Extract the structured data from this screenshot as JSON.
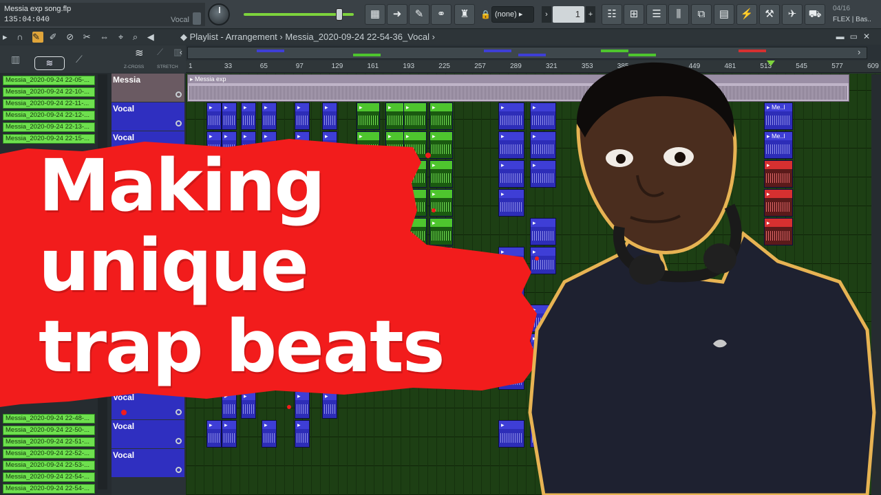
{
  "app": {
    "song_file": "Messia exp song.flp",
    "song_time": "135:04:040",
    "channel_label": "Vocal",
    "pattern_selector": "(none)",
    "pattern_number": "1",
    "version_date": "04/16",
    "version_plugin": "FLEX | Bas.."
  },
  "toolbar": {
    "icons": [
      "piano-icon",
      "arrow-right-icon",
      "brush-icon",
      "link-icon",
      "stamp-icon",
      "playlist-icon",
      "piano-roll-icon",
      "channel-rack-icon",
      "mixer-icon",
      "browser-icon",
      "file-icon",
      "plugin-icon",
      "person-icon",
      "bird-icon",
      "cart-icon"
    ]
  },
  "playlist": {
    "title": "Playlist - Arrangement",
    "separator": "›",
    "selected_clip": "Messia_2020-09-24 22-54-36_Vocal",
    "zcross_label": "Z-CROSS",
    "stretch_label": "STRETCH",
    "ruler_ticks": [
      "1",
      "33",
      "65",
      "97",
      "129",
      "161",
      "193",
      "225",
      "257",
      "289",
      "321",
      "353",
      "385",
      "417",
      "449",
      "481",
      "513",
      "545",
      "577",
      "609"
    ],
    "tracks": [
      {
        "name": "Messia",
        "clip_label": "Messia exp"
      },
      {
        "name": "Vocal"
      },
      {
        "name": "Vocal"
      },
      {
        "name": "Vocal"
      },
      {
        "name": "Vocal"
      },
      {
        "name": "Vocal"
      },
      {
        "name": "Vocal"
      },
      {
        "name": "Vocal"
      },
      {
        "name": "Vocal"
      },
      {
        "name": "Vocal"
      },
      {
        "name": "Vocal"
      },
      {
        "name": "Vocal"
      },
      {
        "name": "Vocal"
      },
      {
        "name": "Vocal"
      }
    ],
    "clip_tag": "Me..l"
  },
  "picker": {
    "items": [
      "Messia_2020-09-24 22-05-...",
      "Messia_2020-09-24 22-10-...",
      "Messia_2020-09-24 22-11-...",
      "Messia_2020-09-24 22-12-...",
      "Messia_2020-09-24 22-13-...",
      "Messia_2020-09-24 22-15-...",
      "Messia_2020-09-24 22-48-...",
      "Messia_2020-09-24 22-50-...",
      "Messia_2020-09-24 22-51-...",
      "Messia_2020-09-24 22-52-...",
      "Messia_2020-09-24 22-53-...",
      "Messia_2020-09-24 22-54-..."
    ],
    "partial_item": "Messia_2020",
    "last_item": "Messia_2020-09-24 22-54-..."
  },
  "thumbnail": {
    "line1": "Making",
    "line2": "unique",
    "line3": "trap beats",
    "accent_color": "#f21c1c"
  }
}
